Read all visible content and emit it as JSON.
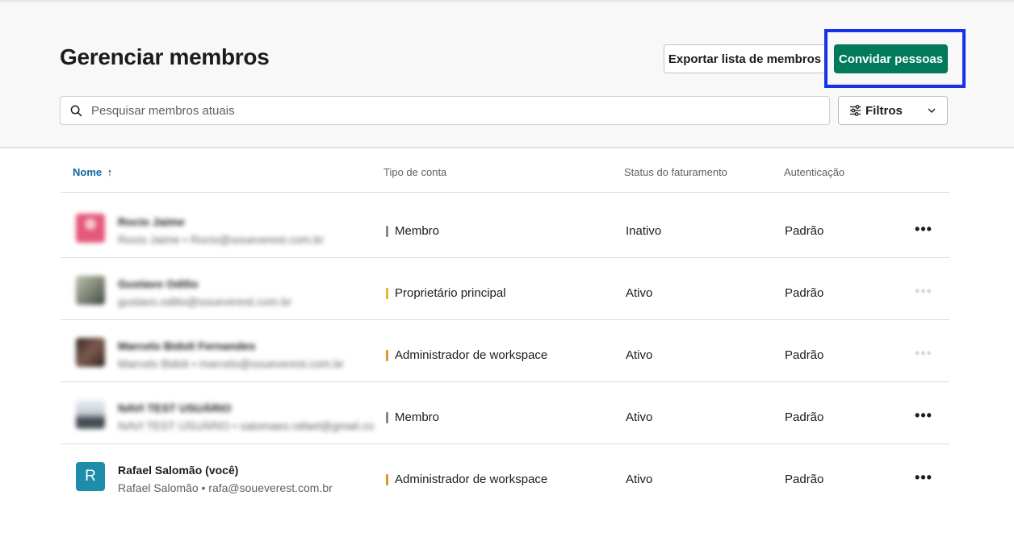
{
  "header": {
    "title": "Gerenciar membros",
    "export_label": "Exportar lista de membros",
    "invite_label": "Convidar pessoas"
  },
  "search": {
    "placeholder": "Pesquisar membros atuais"
  },
  "filters": {
    "label": "Filtros"
  },
  "table": {
    "columns": [
      "Nome",
      "Tipo de conta",
      "Status do faturamento",
      "Autenticação"
    ],
    "sort_indicator": "↑",
    "rows": [
      {
        "name": "Rocio Jaime",
        "subtitle": "Rocio Jaime • Rocio@soueverest.com.br",
        "account_type": "Membro",
        "type_color": "#868686",
        "billing": "Inativo",
        "auth": "Padrão",
        "blurred": true,
        "actions": "•••",
        "avatar_color": "#e5587a"
      },
      {
        "name": "Gustavo Odilio",
        "subtitle": "gustavo.odilio@soueverest.com.br",
        "account_type": "Proprietário principal",
        "type_color": "#ecb22e",
        "billing": "Ativo",
        "auth": "Padrão",
        "blurred": true,
        "actions": "•••",
        "avatar_color": "#8b8f86"
      },
      {
        "name": "Marcelo Bidoli Fernandes",
        "subtitle": "Marcelo Bidoli • marcelo@soueverest.com.br",
        "account_type": "Administrador de workspace",
        "type_color": "#e8912d",
        "billing": "Ativo",
        "auth": "Padrão",
        "blurred": true,
        "actions": "•••",
        "avatar_color": "#6a4a3f"
      },
      {
        "name": "NAVI TEST USUÁRIO",
        "subtitle": "NAVI TEST USUÁRIO • satomaes.rafael@gmail.co",
        "account_type": "Membro",
        "type_color": "#868686",
        "billing": "Ativo",
        "auth": "Padrão",
        "blurred": true,
        "actions": "•••",
        "avatar_color": "#4a4f58"
      },
      {
        "name": "Rafael Salomão (você)",
        "subtitle": "Rafael Salomão • rafa@soueverest.com.br",
        "account_type": "Administrador de workspace",
        "type_color": "#e8912d",
        "billing": "Ativo",
        "auth": "Padrão",
        "blurred": false,
        "actions": "•••",
        "avatar_letter": "R",
        "avatar_color": "#1d8dab"
      }
    ]
  }
}
